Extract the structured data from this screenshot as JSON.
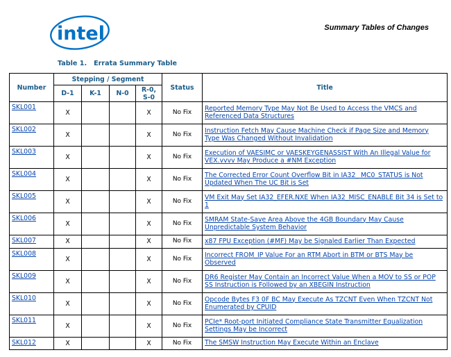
{
  "header": {
    "logo_alt": "intel",
    "section_title": "Summary Tables of Changes"
  },
  "colors": {
    "intel_blue": "#0071c5",
    "header_text": "#1a5c8a",
    "link": "#0645ad"
  },
  "table": {
    "caption": "Table 1.   Errata Summary Table",
    "headers": {
      "number": "Number",
      "stepping_group": "Stepping / Segment",
      "steppings": [
        "D-1",
        "K-1",
        "N-0",
        "R-0, S-0"
      ],
      "status": "Status",
      "title": "Title"
    },
    "rows": [
      {
        "number": "SKL001",
        "marks": [
          "X",
          "",
          "",
          "X"
        ],
        "status": "No Fix",
        "title": "Reported Memory Type May Not Be Used to Access the VMCS and Referenced Data Structures"
      },
      {
        "number": "SKL002",
        "marks": [
          "X",
          "",
          "",
          "X"
        ],
        "status": "No Fix",
        "title": "Instruction Fetch May Cause Machine Check if Page Size and Memory Type Was Changed Without Invalidation"
      },
      {
        "number": "SKL003",
        "marks": [
          "X",
          "",
          "",
          "X"
        ],
        "status": "No Fix",
        "title": "Execution of VAESIMC or VAESKEYGENASSIST With An Illegal Value for VEX.vvvv May Produce a #NM Exception"
      },
      {
        "number": "SKL004",
        "marks": [
          "X",
          "",
          "",
          "X"
        ],
        "status": "No Fix",
        "title": "The Corrected Error Count Overflow Bit in IA32_ MC0_STATUS is Not Updated When The UC Bit is Set"
      },
      {
        "number": "SKL005",
        "marks": [
          "X",
          "",
          "",
          "X"
        ],
        "status": "No Fix",
        "title": "VM Exit May Set IA32_EFER.NXE When IA32_MISC_ENABLE Bit 34 is Set to 1"
      },
      {
        "number": "SKL006",
        "marks": [
          "X",
          "",
          "",
          "X"
        ],
        "status": "No Fix",
        "title": "SMRAM State-Save Area Above the 4GB Boundary May Cause Unpredictable System Behavior"
      },
      {
        "number": "SKL007",
        "marks": [
          "X",
          "",
          "",
          "X"
        ],
        "status": "No Fix",
        "title": "x87 FPU Exception (#MF) May be Signaled Earlier Than Expected"
      },
      {
        "number": "SKL008",
        "marks": [
          "X",
          "",
          "",
          "X"
        ],
        "status": "No Fix",
        "title": "Incorrect FROM_IP Value For an RTM Abort in BTM or BTS May be Observed"
      },
      {
        "number": "SKL009",
        "marks": [
          "X",
          "",
          "",
          "X"
        ],
        "status": "No Fix",
        "title": "DR6 Register May Contain an Incorrect Value When a MOV to SS or POP SS Instruction is Followed by an XBEGIN Instruction"
      },
      {
        "number": "SKL010",
        "marks": [
          "X",
          "",
          "",
          "X"
        ],
        "status": "No Fix",
        "title": "Opcode Bytes F3 0F BC May Execute As TZCNT Even When TZCNT Not Enumerated by CPUID"
      },
      {
        "number": "SKL011",
        "marks": [
          "X",
          "",
          "",
          "X"
        ],
        "status": "No Fix",
        "title": "PCIe* Root-port Initiated Compliance State Transmitter Equalization Settings May be Incorrect"
      },
      {
        "number": "SKL012",
        "marks": [
          "X",
          "",
          "",
          "X"
        ],
        "status": "No Fix",
        "title": "The SMSW Instruction May Execute Within an Enclave"
      }
    ]
  }
}
